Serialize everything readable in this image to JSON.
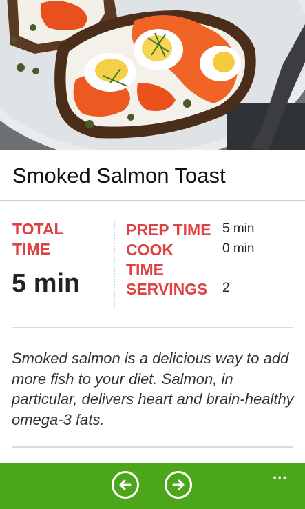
{
  "hero": {
    "image": "smoked-salmon-toast-photo"
  },
  "recipe": {
    "title": "Smoked Salmon Toast",
    "total_label_line1": "TOTAL",
    "total_label_line2": "TIME",
    "total_value": "5 min",
    "prep_label": "PREP TIME",
    "prep_value": "5 min",
    "cook_label_line1": "COOK",
    "cook_label_line2": "TIME",
    "cook_value": "0 min",
    "servings_label": "SERVINGS",
    "servings_value": "2",
    "description": "Smoked salmon is a delicious way to add more fish to your diet. Salmon, in particular, delivers heart and brain-healthy omega-3 fats."
  },
  "appbar": {
    "back_icon": "arrow-left-circle-icon",
    "next_icon": "arrow-right-circle-icon",
    "more_label": "...",
    "color": "#4ca61a"
  },
  "colors": {
    "accent": "#e04040",
    "appbar": "#4ca61a"
  }
}
